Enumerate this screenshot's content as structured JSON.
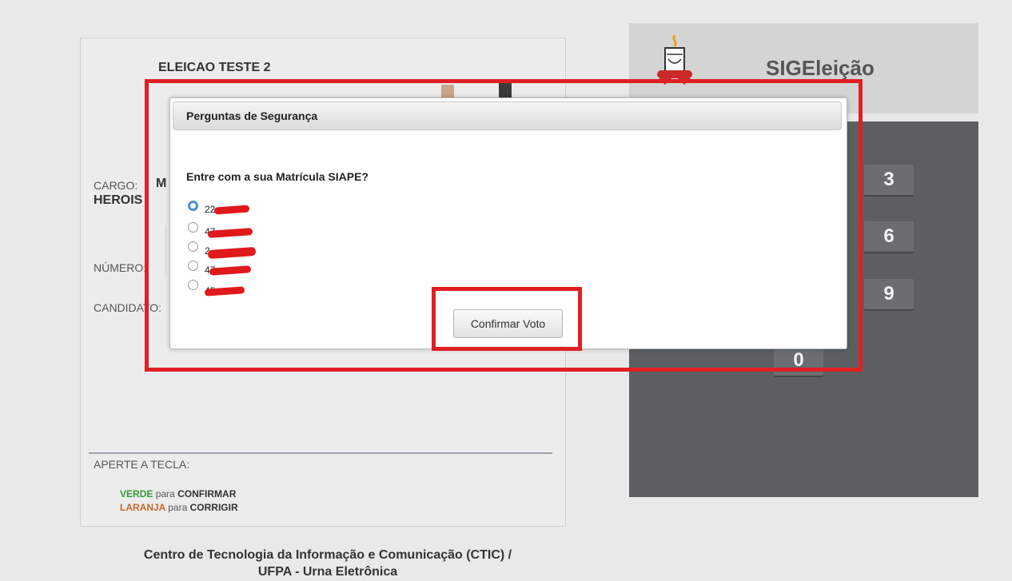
{
  "election": {
    "title": "ELEICAO TESTE 2",
    "cargo_label": "CARGO:",
    "cargo_value_a": "M",
    "cargo_value_b": "HEROIS",
    "numero_label": "NÚMERO:",
    "candidato_label": "CANDIDATO:",
    "instructions": {
      "heading": "APERTE A TECLA:",
      "confirm_color": "VERDE",
      "confirm_mid": "para",
      "confirm_action": "CONFIRMAR",
      "correct_color": "LARANJA",
      "correct_mid": "para",
      "correct_action": "CORRIGIR"
    }
  },
  "footer": {
    "line1": "Centro de Tecnologia da Informação e Comunicação (CTIC) /",
    "line2": "UFPA - Urna Eletrônica"
  },
  "app": {
    "name": "SIGEleição",
    "logo_icon": "university-crest-icon"
  },
  "keypad": {
    "keys": [
      "3",
      "6",
      "9",
      "0"
    ]
  },
  "modal": {
    "title": "Perguntas de Segurança",
    "question": "Entre com a sua Matrícula SIAPE?",
    "options": [
      {
        "text": "22",
        "selected": true
      },
      {
        "text": "47",
        "selected": false
      },
      {
        "text": "2",
        "selected": false
      },
      {
        "text": "47",
        "selected": false
      },
      {
        "text": "45",
        "selected": false
      }
    ],
    "confirm_label": "Confirmar Voto"
  },
  "colors": {
    "annotation": "#e01f24",
    "radio_selected": "#4d8fd6",
    "keypad_bg": "#5b5f62"
  }
}
